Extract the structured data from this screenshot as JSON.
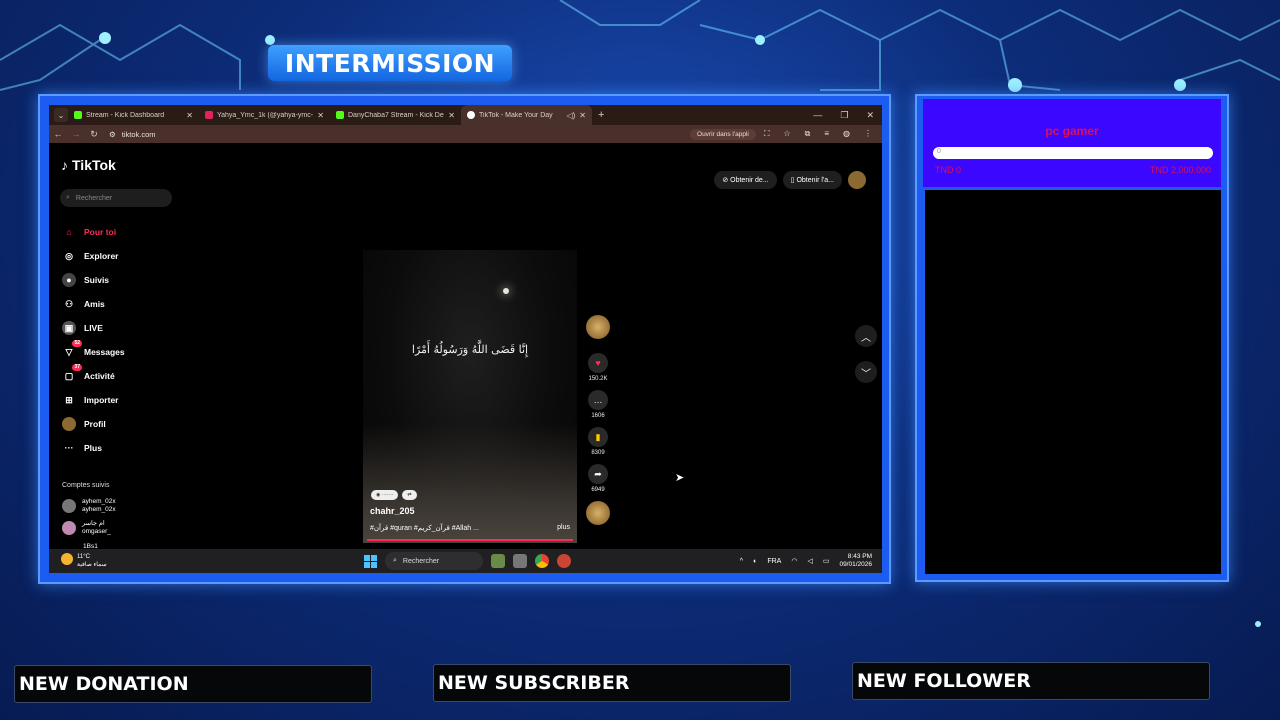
{
  "overlay": {
    "intermission": "INTERMISSION",
    "alerts": [
      "NEW DONATION",
      "NEW SUBSCRIBER",
      "NEW FOLLOWER"
    ]
  },
  "browser": {
    "tabs": [
      {
        "title": "Stream - Kick Dashboard",
        "color": "#53fc18"
      },
      {
        "title": "Yahya_Ymc_1k (@yahya-ymc-",
        "color": "#e0245e"
      },
      {
        "title": "DanyChaba7 Stream - Kick Dei",
        "color": "#53fc18"
      },
      {
        "title": "TikTok - Make Your Day",
        "color": "#ffffff"
      }
    ],
    "url": "tiktok.com",
    "open_app": "Ouvrir dans l'appli"
  },
  "tiktok": {
    "logo": "TikTok",
    "search_placeholder": "Rechercher",
    "nav": [
      {
        "label": "Pour toi",
        "icon": "home-icon",
        "active": true
      },
      {
        "label": "Explorer",
        "icon": "compass-icon"
      },
      {
        "label": "Suivis",
        "icon": "following-icon"
      },
      {
        "label": "Amis",
        "icon": "friends-icon"
      },
      {
        "label": "LIVE",
        "icon": "live-icon"
      },
      {
        "label": "Messages",
        "icon": "messages-icon",
        "badge": "52"
      },
      {
        "label": "Activité",
        "icon": "activity-icon",
        "badge": "37"
      },
      {
        "label": "Importer",
        "icon": "upload-icon"
      },
      {
        "label": "Profil",
        "icon": "profile-icon"
      },
      {
        "label": "Plus",
        "icon": "more-icon"
      }
    ],
    "followed_header": "Comptes suivis",
    "followed": [
      {
        "name": "ayhem_02x",
        "handle": "ayhem_02x"
      },
      {
        "name": "ام جاسر",
        "handle": "omgaser_"
      },
      {
        "name": "",
        "handle": "1Bs1"
      }
    ],
    "top_buttons": [
      "Obtenir de...",
      "Obtenir l'a..."
    ],
    "video": {
      "arabic_text": "إِنَّا قَضَى اللَّهُ وَرَسُولُهُ أَمْرًا",
      "username": "chahr_205",
      "caption": "#قرآن #quran #قرآن_كريم #Allah ...",
      "more": "plus"
    },
    "actions": {
      "likes": "150.2K",
      "comments": "1606",
      "saves": "8309",
      "shares": "6949"
    }
  },
  "taskbar": {
    "temp": "11°C",
    "weather_text": "سماء صافية",
    "search": "Rechercher",
    "lang": "FRA",
    "time": "8:43 PM",
    "date": "09/01/2026"
  },
  "goal": {
    "title": "pc gamer",
    "current": "0",
    "start": "TND 0",
    "target": "TND 2,000.000",
    "progress": 0
  }
}
